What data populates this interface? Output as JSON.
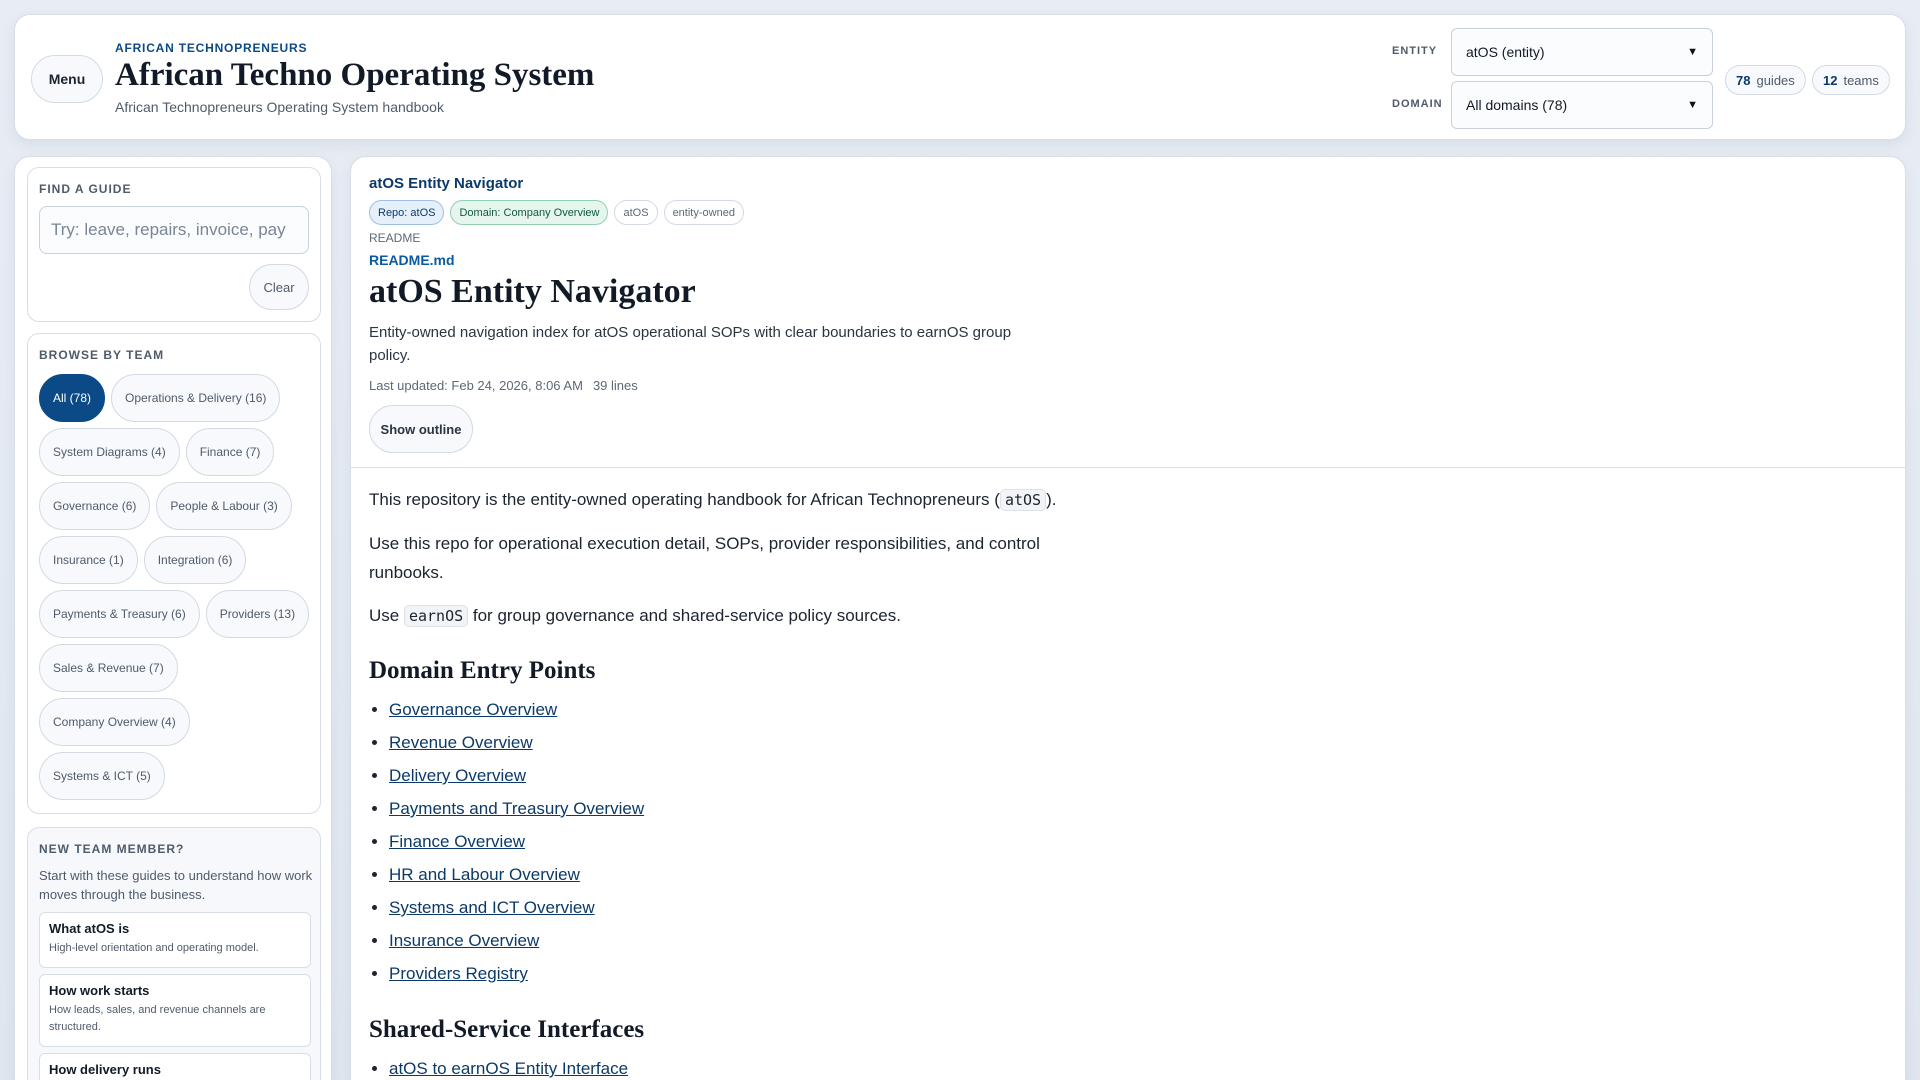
{
  "header": {
    "menu_label": "Menu",
    "eyebrow": "AFRICAN TECHNOPRENEURS",
    "title": "African Techno Operating System",
    "subtitle": "African Technopreneurs Operating System handbook",
    "entity_label": "ENTITY",
    "entity_value": "atOS (entity)",
    "domain_label": "DOMAIN",
    "domain_value": "All domains (78)",
    "stats": {
      "guides_count": "78",
      "guides_label": "guides",
      "teams_count": "12",
      "teams_label": "teams"
    }
  },
  "sidebar": {
    "find": {
      "title": "FIND A GUIDE",
      "placeholder": "Try: leave, repairs, invoice, pay",
      "clear_label": "Clear"
    },
    "browse": {
      "title": "BROWSE BY TEAM",
      "chips": [
        "All (78)",
        "Operations & Delivery (16)",
        "System Diagrams (4)",
        "Finance (7)",
        "Governance (6)",
        "People & Labour (3)",
        "Insurance (1)",
        "Integration (6)",
        "Payments & Treasury (6)",
        "Providers (13)",
        "Sales & Revenue (7)",
        "Company Overview (4)",
        "Systems & ICT (5)"
      ]
    },
    "newbie": {
      "title": "NEW TEAM MEMBER?",
      "text": "Start with these guides to understand how work moves through the business.",
      "items": [
        {
          "title": "What atOS is",
          "desc": "High-level orientation and operating model."
        },
        {
          "title": "How work starts",
          "desc": "How leads, sales, and revenue channels are structured."
        },
        {
          "title": "How delivery runs",
          "desc": ""
        }
      ]
    }
  },
  "main": {
    "crumb": "atOS Entity Navigator",
    "tags": [
      "Repo: atOS",
      "Domain: Company Overview",
      "atOS",
      "entity-owned"
    ],
    "readme_label": "README",
    "file_name": "README.md",
    "title": "atOS Entity Navigator",
    "description": "Entity-owned navigation index for atOS operational SOPs with clear boundaries to earnOS group policy.",
    "last_updated": "Last updated: Feb 24, 2026, 8:06 AM",
    "lines": "39 lines",
    "outline_label": "Show outline",
    "body": {
      "p1_before": "This repository is the entity-owned operating handbook for African Technopreneurs (",
      "p1_code": "atOS",
      "p1_after": ").",
      "p2": "Use this repo for operational execution detail, SOPs, provider responsibilities, and control runbooks.",
      "p3_before": "Use ",
      "p3_code": "earnOS",
      "p3_after": " for group governance and shared-service policy sources.",
      "h_entry": "Domain Entry Points",
      "entry_links": [
        "Governance Overview",
        "Revenue Overview",
        "Delivery Overview",
        "Payments and Treasury Overview",
        "Finance Overview",
        "HR and Labour Overview",
        "Systems and ICT Overview",
        "Insurance Overview",
        "Providers Registry"
      ],
      "h_shared": "Shared-Service Interfaces",
      "shared_links": [
        "atOS to earnOS Entity Interface"
      ]
    }
  }
}
